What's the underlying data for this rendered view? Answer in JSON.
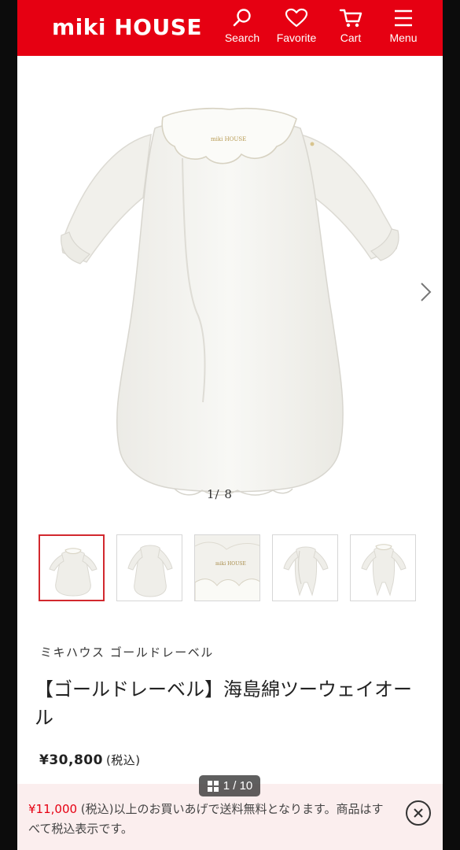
{
  "header": {
    "logo": "miki HOUSE",
    "nav": [
      {
        "label": "Search",
        "icon": "search-icon"
      },
      {
        "label": "Favorite",
        "icon": "heart-icon"
      },
      {
        "label": "Cart",
        "icon": "cart-icon"
      },
      {
        "label": "Menu",
        "icon": "hamburger-icon"
      }
    ]
  },
  "gallery": {
    "counter": "1/  8",
    "thumbnail_count": 5,
    "active_thumbnail": 1
  },
  "product": {
    "brand": "ミキハウス ゴールドレーベル",
    "title": "【ゴールドレーベル】海島綿ツーウェイオール",
    "price": "¥30,800",
    "tax_note": "(税込)"
  },
  "pager": {
    "label": "1 / 10"
  },
  "banner": {
    "amount": "¥11,000",
    "text": " (税込)以上のお買いあげで送料無料となります。商品はすべて税込表示です。"
  },
  "colors": {
    "brand_red": "#e60012",
    "banner_bg": "#fbeeee",
    "active_border": "#d2282e"
  }
}
